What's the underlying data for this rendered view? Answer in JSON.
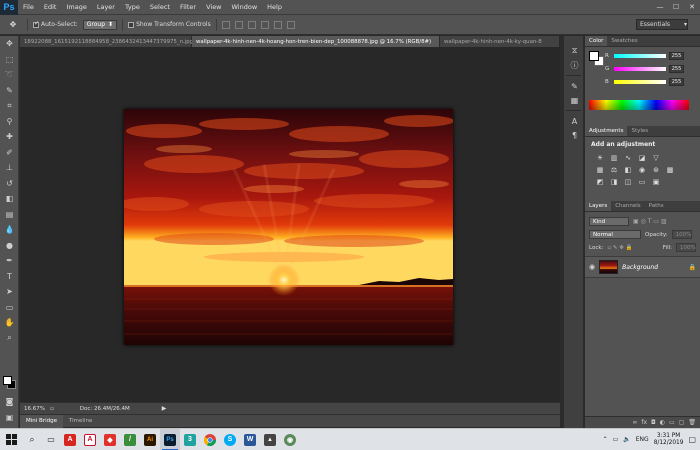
{
  "app": {
    "logo": "Ps"
  },
  "menu": [
    "File",
    "Edit",
    "Image",
    "Layer",
    "Type",
    "Select",
    "Filter",
    "View",
    "Window",
    "Help"
  ],
  "window_controls": {
    "minimize": "—",
    "maximize": "☐",
    "close": "✕"
  },
  "options_bar": {
    "auto_select_label": "Auto-Select:",
    "auto_select_checked": true,
    "auto_select_mode": "Group",
    "show_transform_label": "Show Transform Controls",
    "show_transform_checked": false,
    "workspace": "Essentials"
  },
  "doc_tabs": [
    {
      "label": "18922088_1615192118884958_2386432413447379975_n.jpg",
      "active": false
    },
    {
      "label": "wallpaper-4k-hinh-nen-4k-hoang-hon-tren-bien-dep_100088878.jpg @ 16.7% (RGB/8#)",
      "active": true
    },
    {
      "label": "wallpaper-4k-hinh-nen-4k-ky-quan-8",
      "active": false
    }
  ],
  "status": {
    "zoom": "16.67%",
    "doc_size": "Doc: 26.4M/26.4M",
    "arrow": "▶"
  },
  "bottom_tabs": [
    "Mini Bridge",
    "Timeline"
  ],
  "color_panel": {
    "tabs": [
      "Color",
      "Swatches"
    ],
    "sliders": [
      {
        "label": "R",
        "value": "255",
        "gradient_from": "#00ffff",
        "gradient_to": "#ffffff"
      },
      {
        "label": "G",
        "value": "255",
        "gradient_from": "#ff00ff",
        "gradient_to": "#ffffff"
      },
      {
        "label": "B",
        "value": "255",
        "gradient_from": "#ffff00",
        "gradient_to": "#ffffff"
      }
    ]
  },
  "adjustments_panel": {
    "tabs": [
      "Adjustments",
      "Styles"
    ],
    "title": "Add an adjustment",
    "icons": [
      "brightness-icon",
      "levels-icon",
      "curves-icon",
      "exposure-icon",
      "vibrance-icon",
      "gradient-map-icon",
      "hue-saturation-icon",
      "color-balance-icon",
      "black-white-icon",
      "photo-filter-icon",
      "channel-mixer-icon",
      "color-lookup-icon",
      "invert-icon",
      "posterize-icon",
      "threshold-icon",
      "selective-color-icon",
      "gradient-icon"
    ]
  },
  "layers_panel": {
    "tabs": [
      "Layers",
      "Channels",
      "Paths"
    ],
    "filter_kind": "Kind",
    "blend_mode": "Normal",
    "opacity_label": "Opacity:",
    "opacity_value": "100%",
    "lock_label": "Lock:",
    "fill_label": "Fill:",
    "fill_value": "100%",
    "layer_name": "Background"
  },
  "taskbar": {
    "time": "3:31 PM",
    "date": "8/12/2019",
    "lang": "ENG",
    "apps": [
      {
        "name": "acrobat",
        "glyph": "A",
        "color": "#d7261f",
        "active": false
      },
      {
        "name": "autocad",
        "glyph": "A",
        "color": "#c8102e",
        "active": false
      },
      {
        "name": "app-red",
        "glyph": "◆",
        "color": "#e0312a",
        "active": false
      },
      {
        "name": "app-green",
        "glyph": "/",
        "color": "#3a8d3a",
        "active": false
      },
      {
        "name": "illustrator",
        "glyph": "Ai",
        "color": "#2b1800",
        "active": false
      },
      {
        "name": "photoshop",
        "glyph": "Ps",
        "color": "#0b1c2e",
        "active": true
      },
      {
        "name": "app-3",
        "glyph": "3",
        "color": "#20a39e",
        "active": false
      },
      {
        "name": "chrome",
        "glyph": "●",
        "color": "#ffffff",
        "active": false
      },
      {
        "name": "skype",
        "glyph": "S",
        "color": "#00a9f0",
        "active": false
      },
      {
        "name": "word",
        "glyph": "W",
        "color": "#2b579a",
        "active": false
      },
      {
        "name": "photos",
        "glyph": "▲",
        "color": "#444444",
        "active": false
      },
      {
        "name": "app-globe",
        "glyph": "◉",
        "color": "#5a8a5a",
        "active": false
      }
    ]
  }
}
